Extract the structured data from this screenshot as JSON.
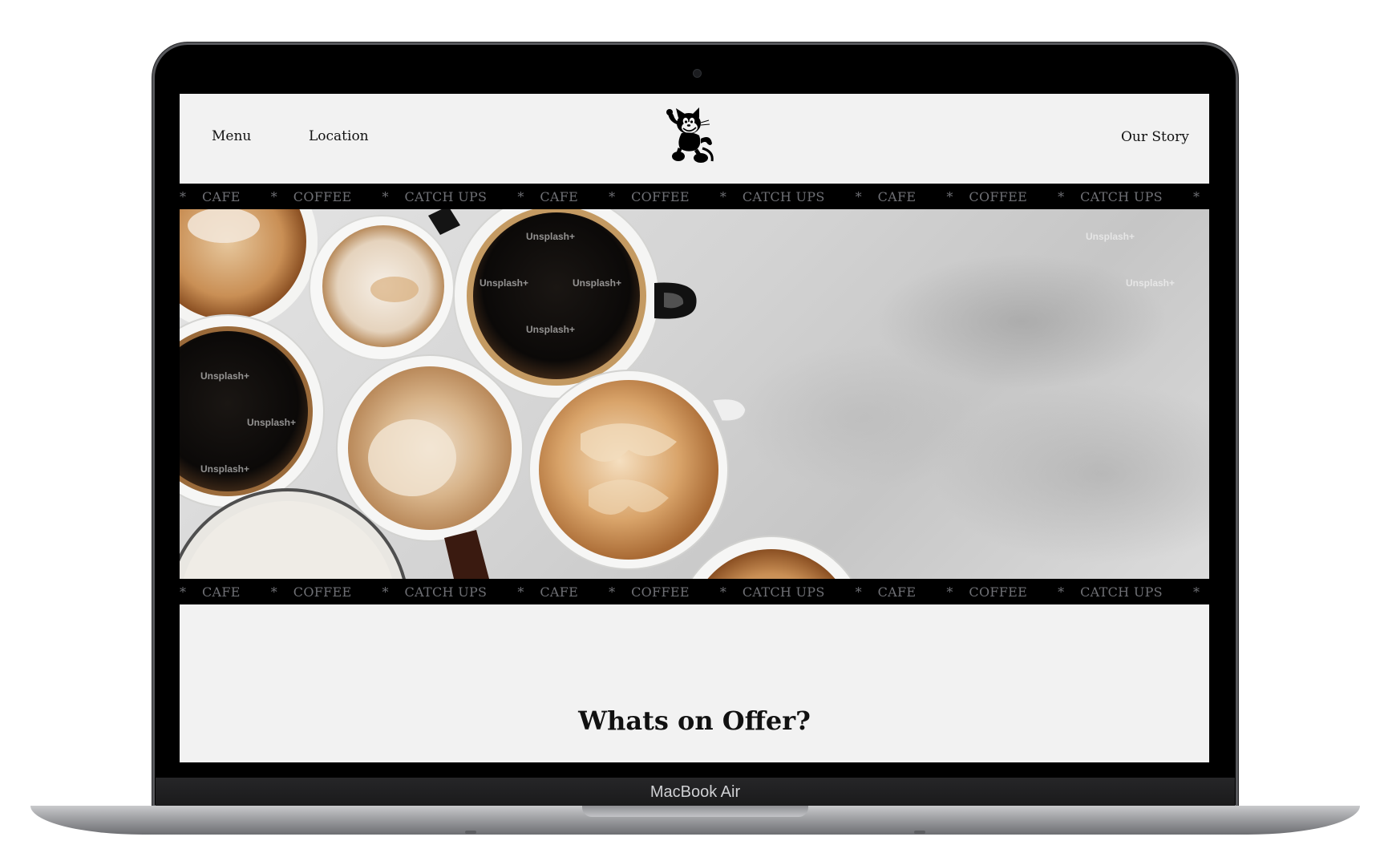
{
  "device": {
    "label": "MacBook Air"
  },
  "nav": {
    "left_links": [
      "Menu",
      "Location"
    ],
    "right_link": "Our Story"
  },
  "ticker": {
    "items": [
      "CAFE",
      "COFFEE",
      "CATCH UPS",
      "CAFE",
      "COFFEE",
      "CATCH UPS",
      "CAFE",
      "COFFEE",
      "CATCH UPS",
      "CAFE",
      "COFFEE"
    ],
    "separator": "*"
  },
  "hero": {
    "watermark": "Unsplash+"
  },
  "offer": {
    "title": "Whats on Offer?"
  },
  "colors": {
    "page_bg": "#f2f2f2",
    "ticker_bg": "#000000",
    "ticker_text": "#6f7075"
  }
}
